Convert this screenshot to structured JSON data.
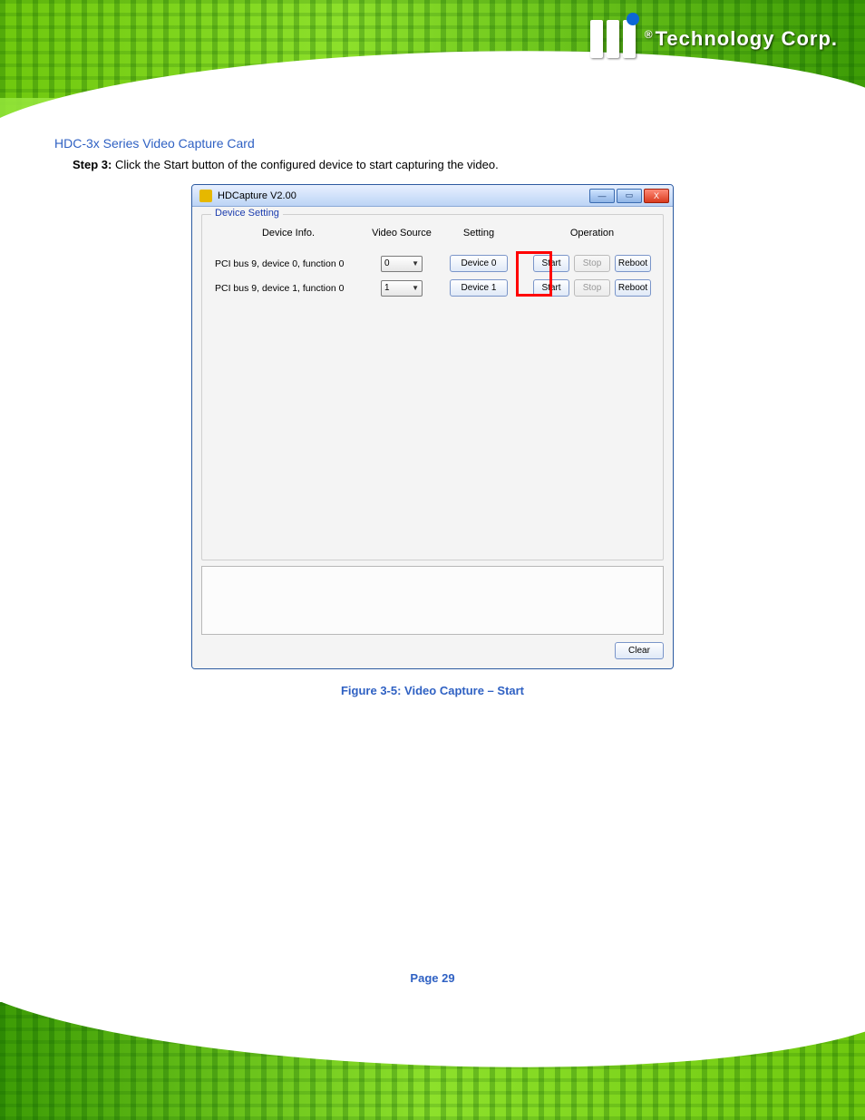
{
  "document": {
    "title_text": "HDC-3x Series Video Capture Card",
    "step_prefix": "Step 3:",
    "step_text": "Click the Start button of the configured device to start capturing the video.",
    "figure_caption": "Figure 3-5: Video Capture – Start",
    "page_number": "Page 29"
  },
  "brand": {
    "reg": "®",
    "text": "Technology Corp."
  },
  "app": {
    "window_title": "HDCapture V2.00",
    "win_buttons": {
      "min": "—",
      "max": "▭",
      "close": "X"
    },
    "group_title": "Device Setting",
    "headers": {
      "info": "Device Info.",
      "source": "Video Source",
      "setting": "Setting",
      "operation": "Operation"
    },
    "rows": [
      {
        "info": "PCI bus 9, device 0, function 0",
        "source": "0",
        "setting": "Device 0",
        "start": "Start",
        "stop": "Stop",
        "reboot": "Reboot"
      },
      {
        "info": "PCI bus 9, device 1, function 0",
        "source": "1",
        "setting": "Device 1",
        "start": "Start",
        "stop": "Stop",
        "reboot": "Reboot"
      }
    ],
    "clear_label": "Clear"
  }
}
